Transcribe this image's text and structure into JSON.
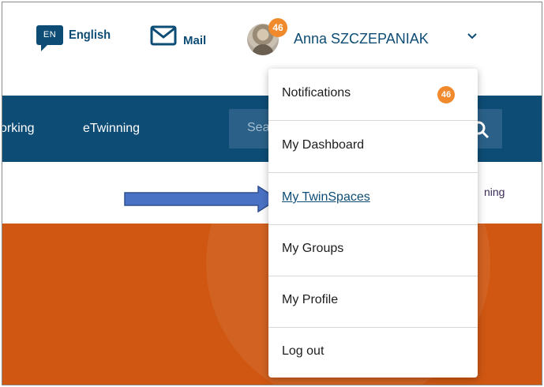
{
  "header": {
    "language_code": "EN",
    "language_label": "English",
    "mail_label": "Mail",
    "notification_count": "46",
    "user_name": "Anna SZCZEPANIAK"
  },
  "nav": {
    "items": [
      {
        "label": "orking"
      },
      {
        "label": "eTwinning"
      }
    ],
    "search_placeholder": "Sea"
  },
  "subnav": {
    "partial_label": "ning"
  },
  "menu": {
    "items": [
      {
        "label": "Notifications",
        "badge": "46"
      },
      {
        "label": "My Dashboard"
      },
      {
        "label": "My TwinSpaces"
      },
      {
        "label": "My Groups"
      },
      {
        "label": "My Profile"
      },
      {
        "label": "Log out"
      }
    ],
    "highlighted_item": "My TwinSpaces"
  },
  "colors": {
    "brand_navy": "#0d4c75",
    "badge_orange": "#f08a2c",
    "hero_orange": "#cf5712",
    "arrow_blue": "#4a72c4"
  }
}
